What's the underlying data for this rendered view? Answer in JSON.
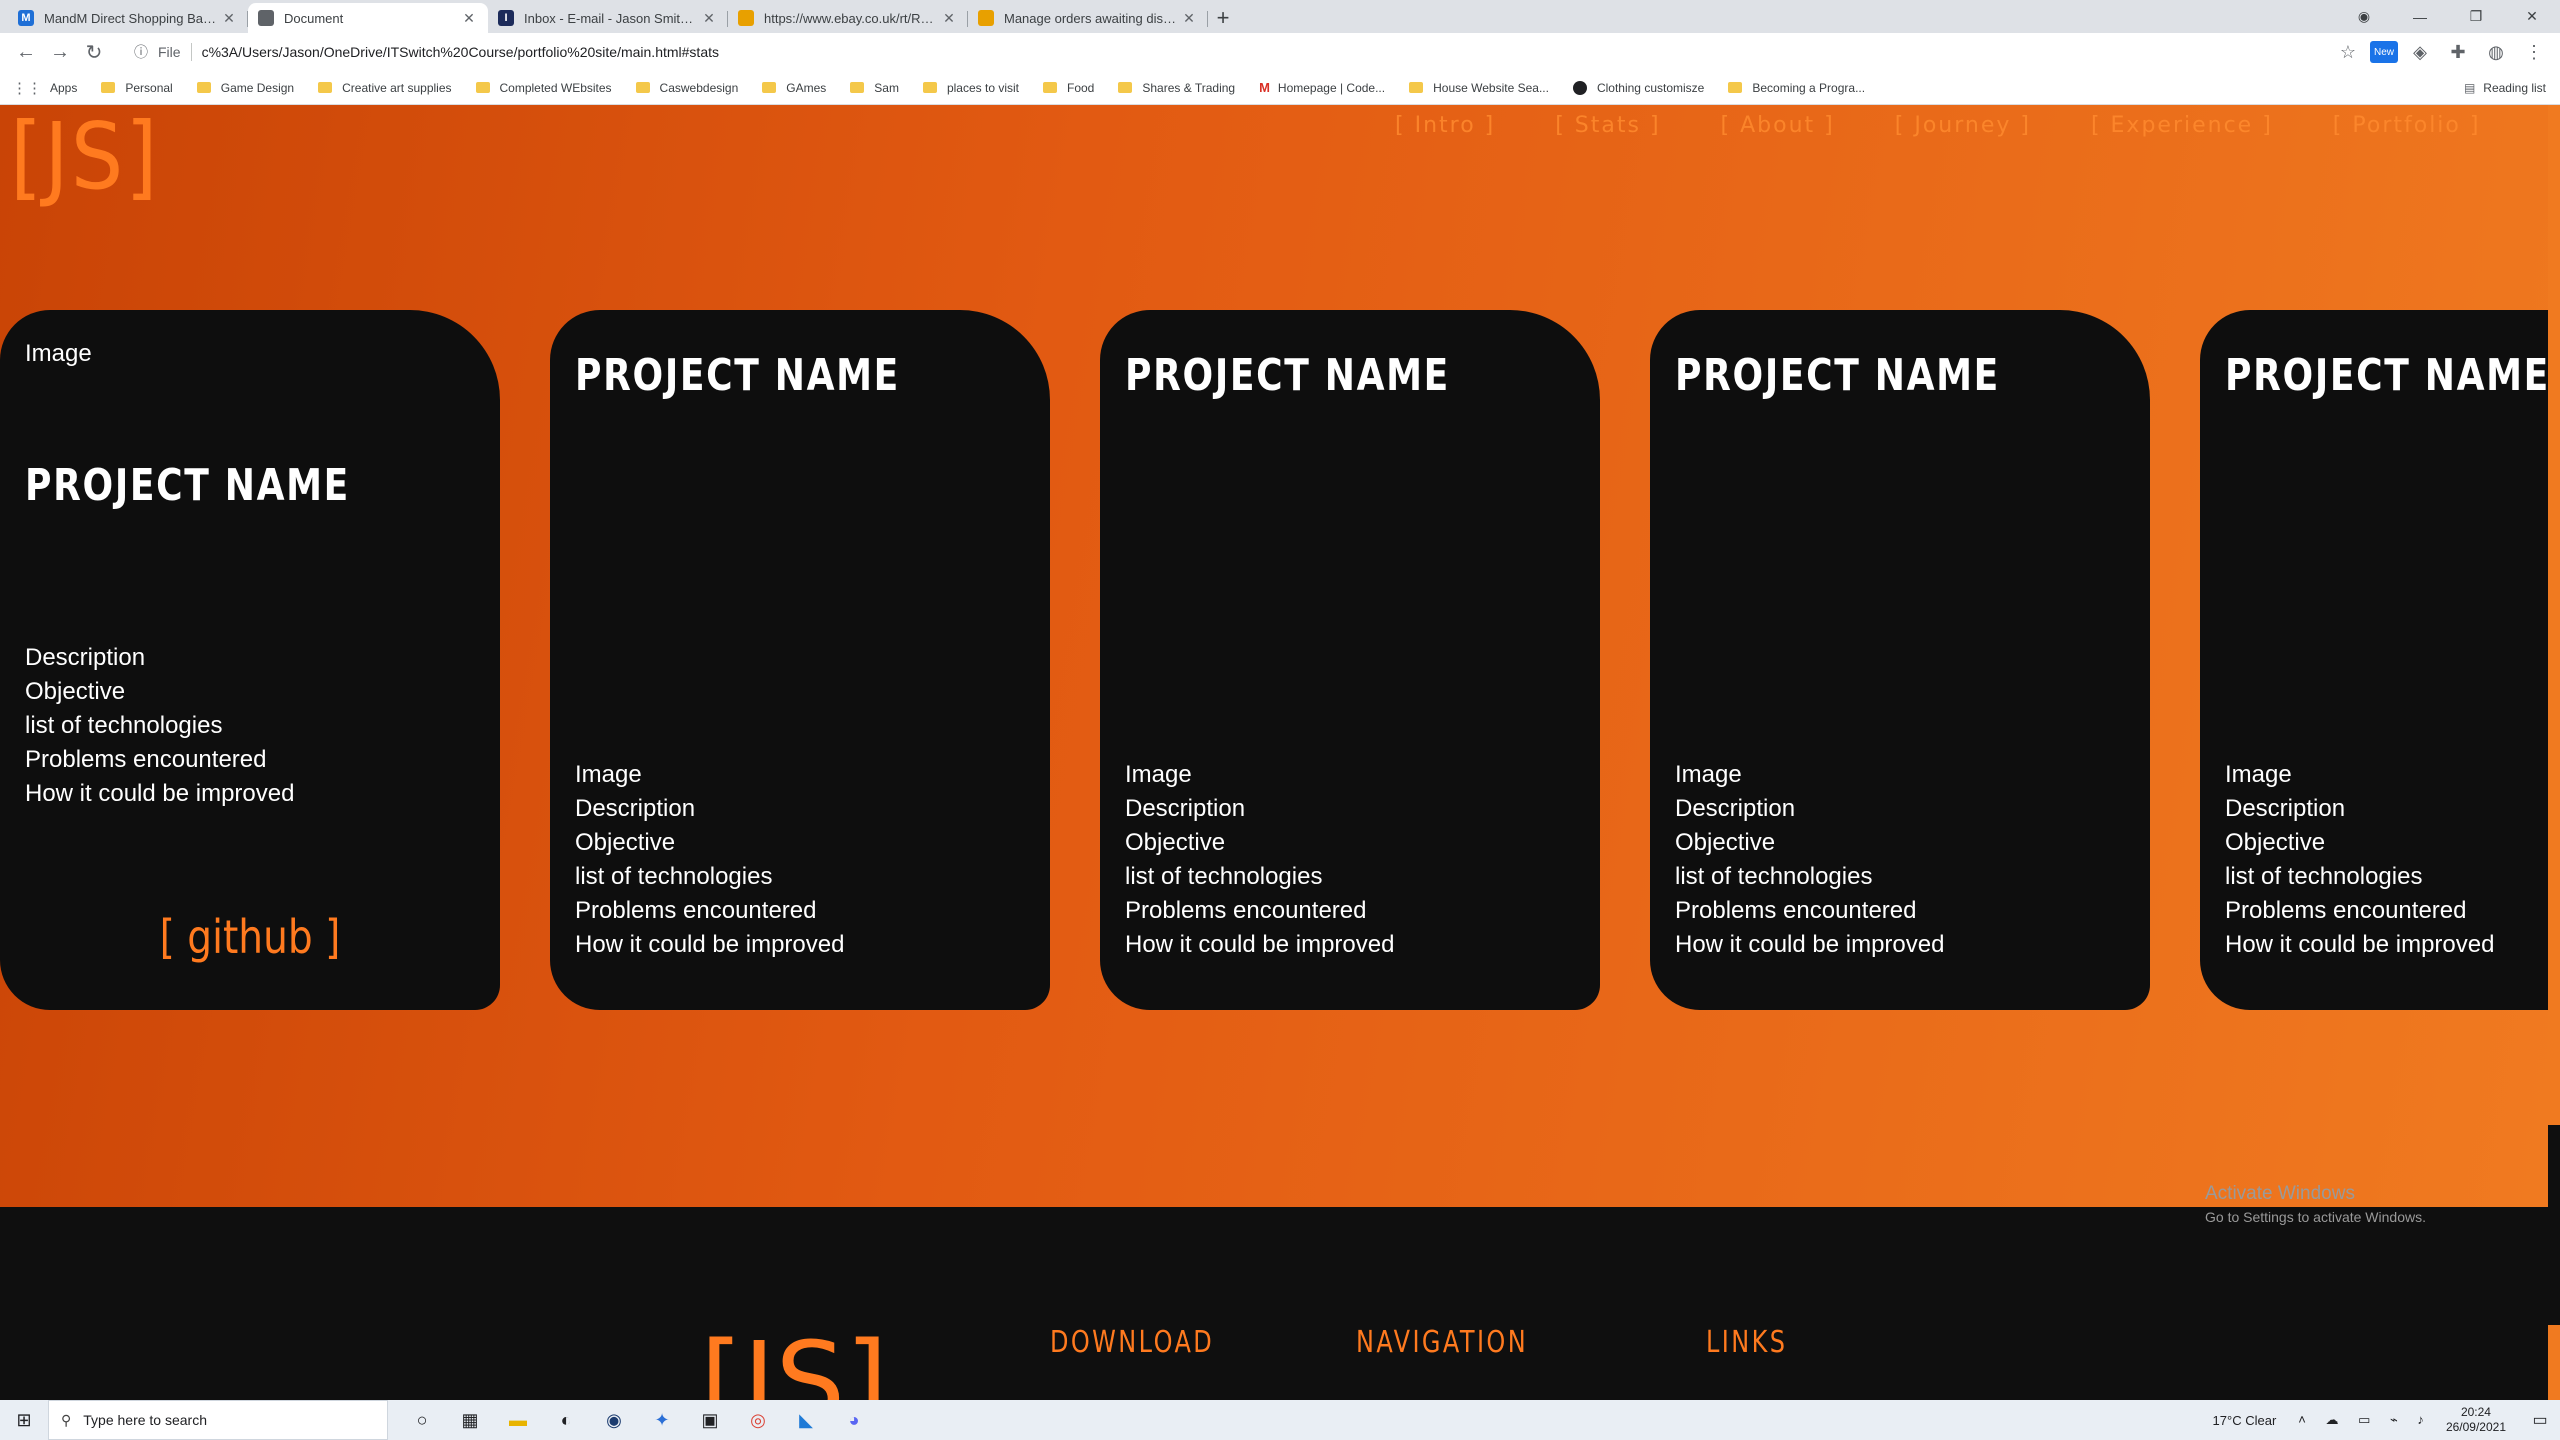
{
  "browser": {
    "tabs": [
      {
        "title": "MandM Direct Shopping Basket",
        "fav": "M",
        "color": "#1f6fd6",
        "active": false
      },
      {
        "title": "Document",
        "fav": "",
        "color": "#5f6368",
        "active": true
      },
      {
        "title": "Inbox - E-mail - Jason Smith - M",
        "fav": "I",
        "color": "#1c2b5a",
        "active": false
      },
      {
        "title": "https://www.ebay.co.uk/rt/Return",
        "fav": "",
        "color": "#e8a000",
        "active": false
      },
      {
        "title": "Manage orders awaiting dispatch",
        "fav": "",
        "color": "#e8a000",
        "active": false
      }
    ],
    "newtab": "+",
    "address": {
      "scheme": "File",
      "url": "c%3A/Users/Jason/OneDrive/ITSwitch%20Course/portfolio%20site/main.html#stats"
    },
    "bookmarks": [
      {
        "label": "Apps",
        "kind": "apps"
      },
      {
        "label": "Personal",
        "kind": "folder"
      },
      {
        "label": "Game Design",
        "kind": "folder"
      },
      {
        "label": "Creative art supplies",
        "kind": "folder"
      },
      {
        "label": "Completed WEbsites",
        "kind": "folder"
      },
      {
        "label": "Caswebdesign",
        "kind": "folder"
      },
      {
        "label": "GAmes",
        "kind": "folder"
      },
      {
        "label": "Sam",
        "kind": "folder"
      },
      {
        "label": "places to visit",
        "kind": "folder"
      },
      {
        "label": "Food",
        "kind": "folder"
      },
      {
        "label": "Shares & Trading",
        "kind": "folder"
      },
      {
        "label": "Homepage | Code...",
        "kind": "mk"
      },
      {
        "label": "House Website Sea...",
        "kind": "folder"
      },
      {
        "label": "Clothing customisze",
        "kind": "circ"
      },
      {
        "label": "Becoming a Progra...",
        "kind": "folder"
      }
    ],
    "reading_list": "Reading list"
  },
  "page": {
    "logo": "[JS]",
    "nav": [
      "[ Intro ]",
      "[ Stats ]",
      "[ About ]",
      "[ Journey ]",
      "[ Experience ]",
      "[ Portfolio ]"
    ],
    "cards": [
      {
        "image_label": "Image",
        "project_name": "PROJECT NAME",
        "lines": [
          "Description",
          "Objective",
          "list of technologies",
          "Problems encountered",
          "How it could be improved"
        ],
        "link": "[ github ]"
      },
      {
        "project_name": "PROJECT NAME",
        "lines": [
          "Image",
          "Description",
          "Objective",
          "list of technologies",
          "Problems encountered",
          "How it could be improved"
        ]
      },
      {
        "project_name": "PROJECT NAME",
        "lines": [
          "Image",
          "Description",
          "Objective",
          "list of technologies",
          "Problems encountered",
          "How it could be improved"
        ]
      },
      {
        "project_name": "PROJECT NAME",
        "lines": [
          "Image",
          "Description",
          "Objective",
          "list of technologies",
          "Problems encountered",
          "How it could be improved"
        ]
      },
      {
        "project_name": "PROJECT NAME",
        "lines": [
          "Image",
          "Description",
          "Objective",
          "list of technologies",
          "Problems encountered",
          "How it could be improved"
        ]
      }
    ],
    "footer": {
      "logo": "[JS]",
      "headings": [
        "DOWNLOAD",
        "NAVIGATION",
        "LINKS"
      ]
    },
    "watermark": {
      "line1": "Activate Windows",
      "line2": "Go to Settings to activate Windows."
    }
  },
  "taskbar": {
    "search_placeholder": "Type here to search",
    "weather": "17°C  Clear",
    "time": "20:24",
    "date": "26/09/2021"
  },
  "colors": {
    "accent": "#ff7a1f",
    "card": "#0e0e0e",
    "gradient_start": "#c94406",
    "gradient_end": "#f07a20"
  }
}
